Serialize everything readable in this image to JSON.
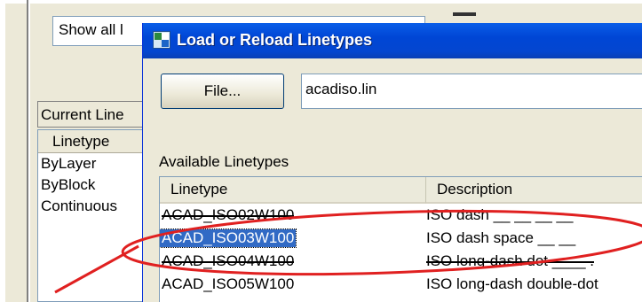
{
  "parent_dialog": {
    "show_filter_value": "Show all l",
    "current_linetype_label": "Current Line",
    "linetype_list": {
      "header": "Linetype",
      "items": [
        "ByLayer",
        "ByBlock",
        "Continuous"
      ]
    }
  },
  "dialog": {
    "title": "Load or Reload Linetypes",
    "icon": "autocad-app-icon",
    "file_button_label": "File...",
    "file_value": "acadiso.lin",
    "available_label": "Available Linetypes",
    "columns": [
      "Linetype",
      "Description"
    ],
    "rows": [
      {
        "linetype": "ACAD_ISO02W100",
        "description": "ISO dash __ __ __ __",
        "selected": false
      },
      {
        "linetype": "ACAD_ISO03W100",
        "description": "ISO dash space __ __",
        "selected": true
      },
      {
        "linetype": "ACAD_ISO04W100",
        "description": "ISO long-dash dot ____ .",
        "selected": false
      },
      {
        "linetype": "ACAD_ISO05W100",
        "description": "ISO long-dash double-dot",
        "selected": false
      }
    ]
  },
  "annotation": {
    "color": "#e02020",
    "shape": "ellipse-with-arrow",
    "highlighted_item": "ACAD_ISO03W100"
  }
}
